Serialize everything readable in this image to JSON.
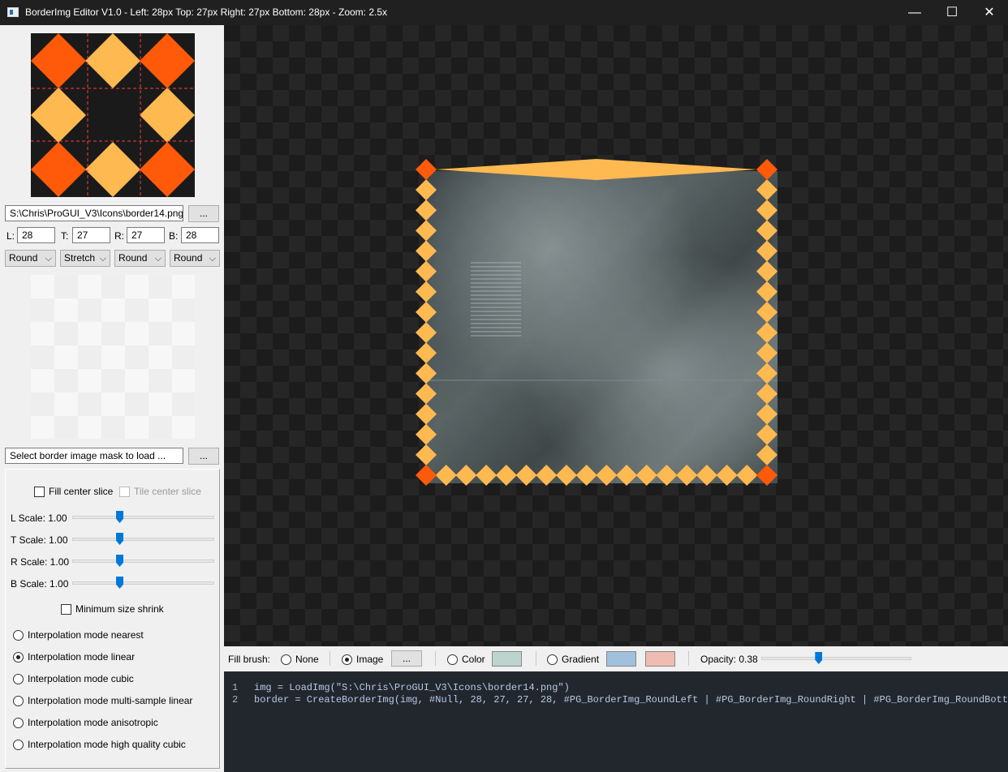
{
  "window": {
    "title": "BorderImg Editor V1.0  -  Left: 28px  Top: 27px  Right: 27px  Bottom: 28px  -  Zoom: 2.5x",
    "minimize_glyph": "—",
    "maximize_glyph": "☐",
    "close_glyph": "✕"
  },
  "sidebar": {
    "image_path": "S:\\Chris\\ProGUI_V3\\Icons\\border14.png",
    "browse_label": "...",
    "slices": [
      {
        "label": "L:",
        "value": "28"
      },
      {
        "label": "T:",
        "value": "27"
      },
      {
        "label": "R:",
        "value": "27"
      },
      {
        "label": "B:",
        "value": "28"
      }
    ],
    "modes": [
      "Round",
      "Stretch",
      "Round",
      "Round"
    ],
    "mask_path": "Select border image mask to load ...",
    "mask_browse_label": "...",
    "fill_center_label": "Fill center slice",
    "tile_center_label": "Tile center slice",
    "scales": [
      {
        "label": "L Scale: 1.00",
        "value": 1.0
      },
      {
        "label": "T Scale: 1.00",
        "value": 1.0
      },
      {
        "label": "R Scale: 1.00",
        "value": 1.0
      },
      {
        "label": "B Scale: 1.00",
        "value": 1.0
      }
    ],
    "min_shrink_label": "Minimum size shrink",
    "interpolation": [
      {
        "label": "Interpolation mode nearest",
        "selected": false
      },
      {
        "label": "Interpolation mode linear",
        "selected": true
      },
      {
        "label": "Interpolation mode cubic",
        "selected": false
      },
      {
        "label": "Interpolation mode multi-sample linear",
        "selected": false
      },
      {
        "label": "Interpolation mode anisotropic",
        "selected": false
      },
      {
        "label": "Interpolation mode high quality cubic",
        "selected": false
      }
    ]
  },
  "fill": {
    "label": "Fill brush:",
    "none_label": "None",
    "image_label": "Image",
    "image_browse": "...",
    "color_label": "Color",
    "color_swatch": "#bdd4ce",
    "gradient_label": "Gradient",
    "gradient_start": "#a0c0dc",
    "gradient_end": "#eebcb0",
    "opacity_label": "Opacity: 0.38",
    "opacity": 0.38,
    "selected": "Image"
  },
  "colors": {
    "diamond_orange": "#ff5a0a",
    "diamond_yellow": "#ffb951",
    "preview_bg": "#1a1a1a"
  },
  "code": {
    "lines": [
      {
        "n": "1",
        "text": "img = LoadImg(\"S:\\Chris\\ProGUI_V3\\Icons\\border14.png\")"
      },
      {
        "n": "2",
        "text": "border = CreateBorderImg(img, #Null, 28, 27, 27, 28, #PG_BorderImg_RoundLeft | #PG_BorderImg_RoundRight | #PG_BorderImg_RoundBottom)"
      }
    ]
  }
}
